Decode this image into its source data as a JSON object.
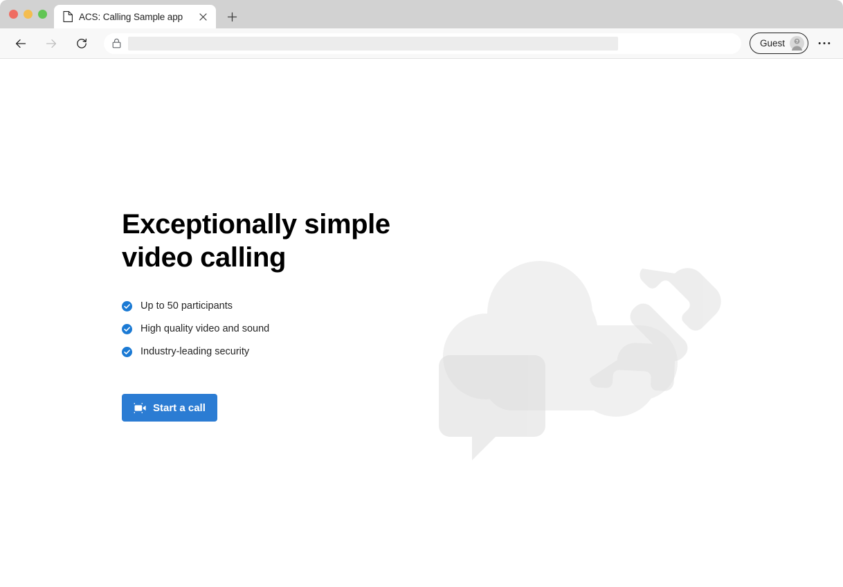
{
  "browser": {
    "window_controls": [
      {
        "name": "close",
        "color": "#ef6d62"
      },
      {
        "name": "minimize",
        "color": "#f4bd4f"
      },
      {
        "name": "maximize",
        "color": "#61c554"
      }
    ],
    "tab": {
      "title": "ACS: Calling Sample app",
      "favicon": "page-icon",
      "close_label": "×"
    },
    "new_tab_label": "+",
    "toolbar": {
      "back_icon": "arrow-left-icon",
      "forward_icon": "arrow-right-icon",
      "reload_icon": "reload-icon",
      "lock_icon": "lock-icon",
      "address_value": "",
      "address_placeholder": "",
      "profile_label": "Guest",
      "profile_avatar_icon": "guest-avatar-icon",
      "more_icon": "ellipsis-icon"
    }
  },
  "page": {
    "hero": {
      "title": "Exceptionally simple\nvideo calling",
      "features": [
        {
          "icon": "check-circle-icon",
          "label": "Up to 50 participants"
        },
        {
          "icon": "check-circle-icon",
          "label": "High quality video and sound"
        },
        {
          "icon": "check-circle-icon",
          "label": "Industry-leading security"
        }
      ],
      "cta": {
        "label": "Start a call",
        "icon": "video-camera-icon"
      }
    },
    "illustration": {
      "name": "cloud-phone-chat-illustration",
      "shapes": [
        "cloud",
        "phone-handset",
        "chat-bubble"
      ]
    }
  },
  "colors": {
    "accent_blue": "#2b7cd3",
    "check_blue": "#1b7ad4",
    "page_background": "#ffffff",
    "titlebar": "#d2d2d2",
    "toolbar": "#f8f8f8",
    "illustration_grey": "#eeeeee"
  }
}
